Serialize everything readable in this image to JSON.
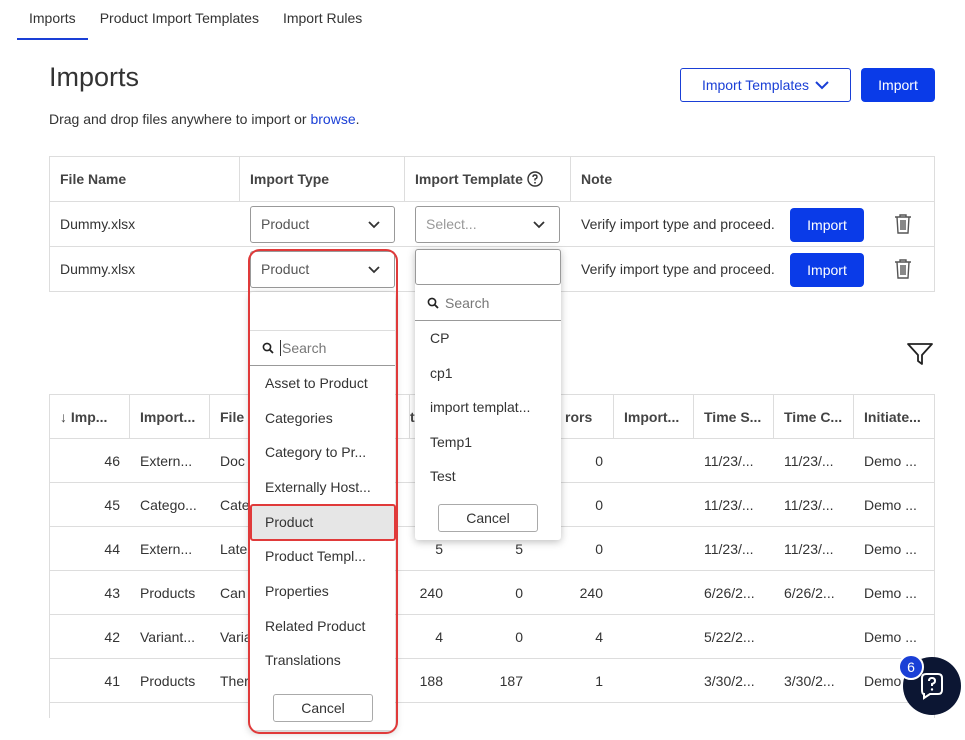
{
  "tabs": [
    {
      "label": "Imports"
    },
    {
      "label": "Product Import Templates"
    },
    {
      "label": "Import Rules"
    }
  ],
  "header": {
    "title": "Imports",
    "subtitle_prefix": "Drag and drop files anywhere to import or ",
    "subtitle_link": "browse",
    "subtitle_suffix": ".",
    "templates_button": "Import Templates",
    "import_button": "Import"
  },
  "upload_table": {
    "columns": [
      "File Name",
      "Import Type",
      "Import Template",
      "Note"
    ],
    "rows": [
      {
        "file": "Dummy.xlsx",
        "type": "Product",
        "template": "Select...",
        "note": "Verify import type and proceed.",
        "import": "Import"
      },
      {
        "file": "Dummy.xlsx",
        "type": "Product",
        "template": "",
        "note": "Verify import type and proceed.",
        "import": "Import"
      }
    ]
  },
  "history_table": {
    "columns": [
      "↓ Imp...",
      "Import...",
      "File",
      "tal",
      "rors",
      "Import...",
      "Time S...",
      "Time C...",
      "Initiate..."
    ],
    "rows": [
      {
        "id": "46",
        "type": "Extern...",
        "file": "Doc",
        "total": "",
        "success": "",
        "errors": "0",
        "template": "",
        "start": "11/23/...",
        "complete": "11/23/...",
        "by": "Demo ..."
      },
      {
        "id": "45",
        "type": "Catego...",
        "file": "Cate",
        "total": "",
        "success": "",
        "errors": "0",
        "template": "",
        "start": "11/23/...",
        "complete": "11/23/...",
        "by": "Demo ..."
      },
      {
        "id": "44",
        "type": "Extern...",
        "file": "Late",
        "total": "5",
        "success": "5",
        "errors": "0",
        "template": "",
        "start": "11/23/...",
        "complete": "11/23/...",
        "by": "Demo ..."
      },
      {
        "id": "43",
        "type": "Products",
        "file": "Can",
        "total": "240",
        "success": "0",
        "errors": "240",
        "template": "",
        "start": "6/26/2...",
        "complete": "6/26/2...",
        "by": "Demo ..."
      },
      {
        "id": "42",
        "type": "Variant...",
        "file": "Varia",
        "total": "4",
        "success": "0",
        "errors": "4",
        "template": "",
        "start": "5/22/2...",
        "complete": "",
        "by": "Demo ..."
      },
      {
        "id": "41",
        "type": "Products",
        "file": "Ther",
        "total": "188",
        "success": "187",
        "errors": "1",
        "template": "",
        "start": "3/30/2...",
        "complete": "3/30/2...",
        "by": "Demo"
      }
    ]
  },
  "type_dropdown": {
    "search_placeholder": "Search",
    "items": [
      "Asset to Product",
      "Categories",
      "Category to Pr...",
      "Externally Host...",
      "Product",
      "Product Templ...",
      "Properties",
      "Related Product",
      "Translations"
    ],
    "selected": "Product",
    "cancel": "Cancel"
  },
  "template_dropdown": {
    "search_placeholder": "Search",
    "items": [
      "CP",
      "cp1",
      "import templat...",
      "Temp1",
      "Test"
    ],
    "cancel": "Cancel"
  },
  "help": {
    "badge": "6",
    "icon": "question-icon"
  },
  "colors": {
    "accent": "#0a3be8",
    "highlight": "#e03a3a",
    "help_bg": "#0c1633"
  }
}
